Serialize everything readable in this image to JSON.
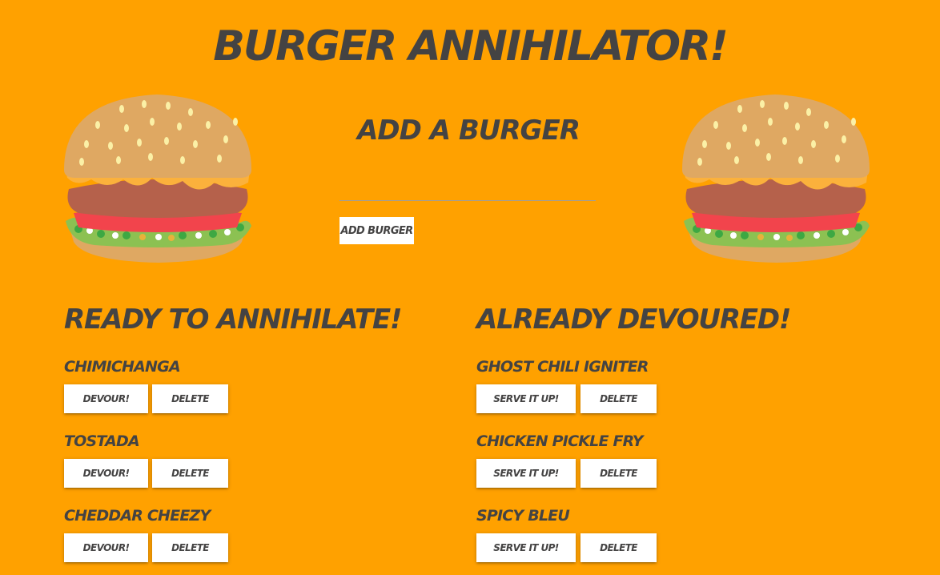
{
  "title": "Burger Annihilator!",
  "add_form": {
    "heading": "Add a Burger",
    "input_value": "",
    "input_placeholder": "",
    "button_label": "Add Burger"
  },
  "images": {
    "left": "burger-icon",
    "right": "burger-icon"
  },
  "ready": {
    "heading": "Ready to Annihilate!",
    "items": [
      {
        "name": "Chimichanga",
        "primary_label": "Devour!",
        "delete_label": "Delete"
      },
      {
        "name": "Tostada",
        "primary_label": "Devour!",
        "delete_label": "Delete"
      },
      {
        "name": "Cheddar Cheezy",
        "primary_label": "Devour!",
        "delete_label": "Delete"
      }
    ]
  },
  "devoured": {
    "heading": "Already Devoured!",
    "items": [
      {
        "name": "Ghost Chili Igniter",
        "primary_label": "Serve it up!",
        "delete_label": "Delete"
      },
      {
        "name": "Chicken Pickle Fry",
        "primary_label": "Serve it up!",
        "delete_label": "Delete"
      },
      {
        "name": "Spicy Bleu",
        "primary_label": "Serve it up!",
        "delete_label": "Delete"
      }
    ]
  },
  "colors": {
    "background": "#ffa100",
    "text": "#444343",
    "button": "#ffffff"
  }
}
